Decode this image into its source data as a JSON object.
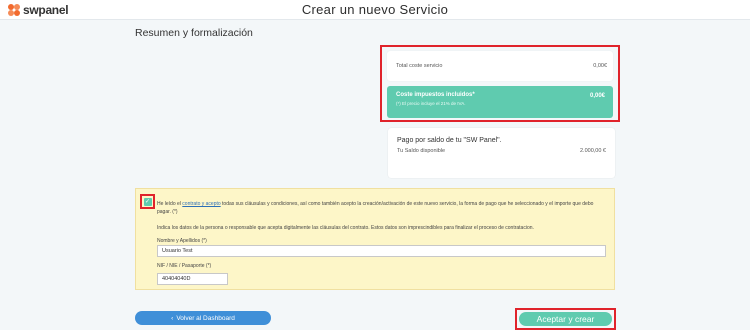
{
  "header": {
    "logo_text": "swpanel",
    "title": "Crear un nuevo Servicio"
  },
  "section_title": "Resumen y formalización",
  "summary": {
    "total_label": "Total coste servicio",
    "total_value": "0,00€",
    "taxes_label": "Coste impuestos incluidos*",
    "taxes_value": "0,00€",
    "taxes_note": "(*) El precio incluye el 21% de IVA."
  },
  "balance": {
    "title": "Pago por saldo de tu \"SW Panel\".",
    "label": "Tu Saldo disponible",
    "value": "2.000,00 €"
  },
  "terms": {
    "checked": true,
    "text_before": "He leído el ",
    "link": "contrato y acepto",
    "text_after": " todas sus cláusulas y condiciones, así como también acepto la creación/activación de este nuevo servicio, la forma de pago que he seleccionado y el importe que debo pagar. (*)",
    "indica": "Indica los datos de la persona o responsable que acepta digitalmente las cláusulas del contrato. Estos datos son imprescindibles para finalizar el proceso de contratacion.",
    "name_label": "Nombre y Apellidos (*)",
    "name_value": "Usuario Test",
    "nif_label": "NIF / NIE / Pasaporte (*)",
    "nif_value": "40404040D"
  },
  "buttons": {
    "back_label": "Volver al Dashboard",
    "accept_label": "Aceptar y crear"
  },
  "colors": {
    "accent": "#5fcbaf",
    "highlight": "#e0232b",
    "brand": "#f26a2e",
    "back_button": "#3f8fd8"
  }
}
